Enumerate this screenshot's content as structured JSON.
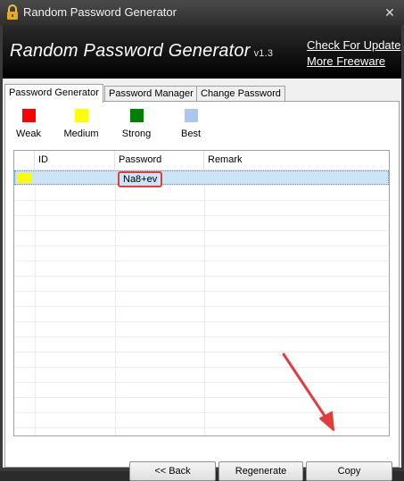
{
  "window": {
    "title": "Random Password Generator",
    "close_glyph": "✕"
  },
  "header": {
    "app_title": "Random Password Generator",
    "version": "v1.3",
    "links": {
      "check_update": "Check For Update",
      "more_freeware": "More Freeware"
    }
  },
  "tabs": [
    {
      "label": "Password Generator",
      "active": true
    },
    {
      "label": "Password Manager",
      "active": false
    },
    {
      "label": "Change Password",
      "active": false
    }
  ],
  "legend": [
    {
      "label": "Weak",
      "color": "#ff0000"
    },
    {
      "label": "Medium",
      "color": "#ffff00"
    },
    {
      "label": "Strong",
      "color": "#008000"
    },
    {
      "label": "Best",
      "color": "#a8c8f0"
    }
  ],
  "list": {
    "columns": [
      "",
      "ID",
      "Password",
      "Remark"
    ],
    "rows": [
      {
        "strength_color": "#ffff00",
        "id": "",
        "password": "Na8+ev",
        "remark": ""
      }
    ]
  },
  "buttons": {
    "back": "<< Back",
    "regenerate": "Regenerate",
    "copy": "Copy"
  },
  "annotation": {
    "highlight_color": "#e23c3c"
  }
}
